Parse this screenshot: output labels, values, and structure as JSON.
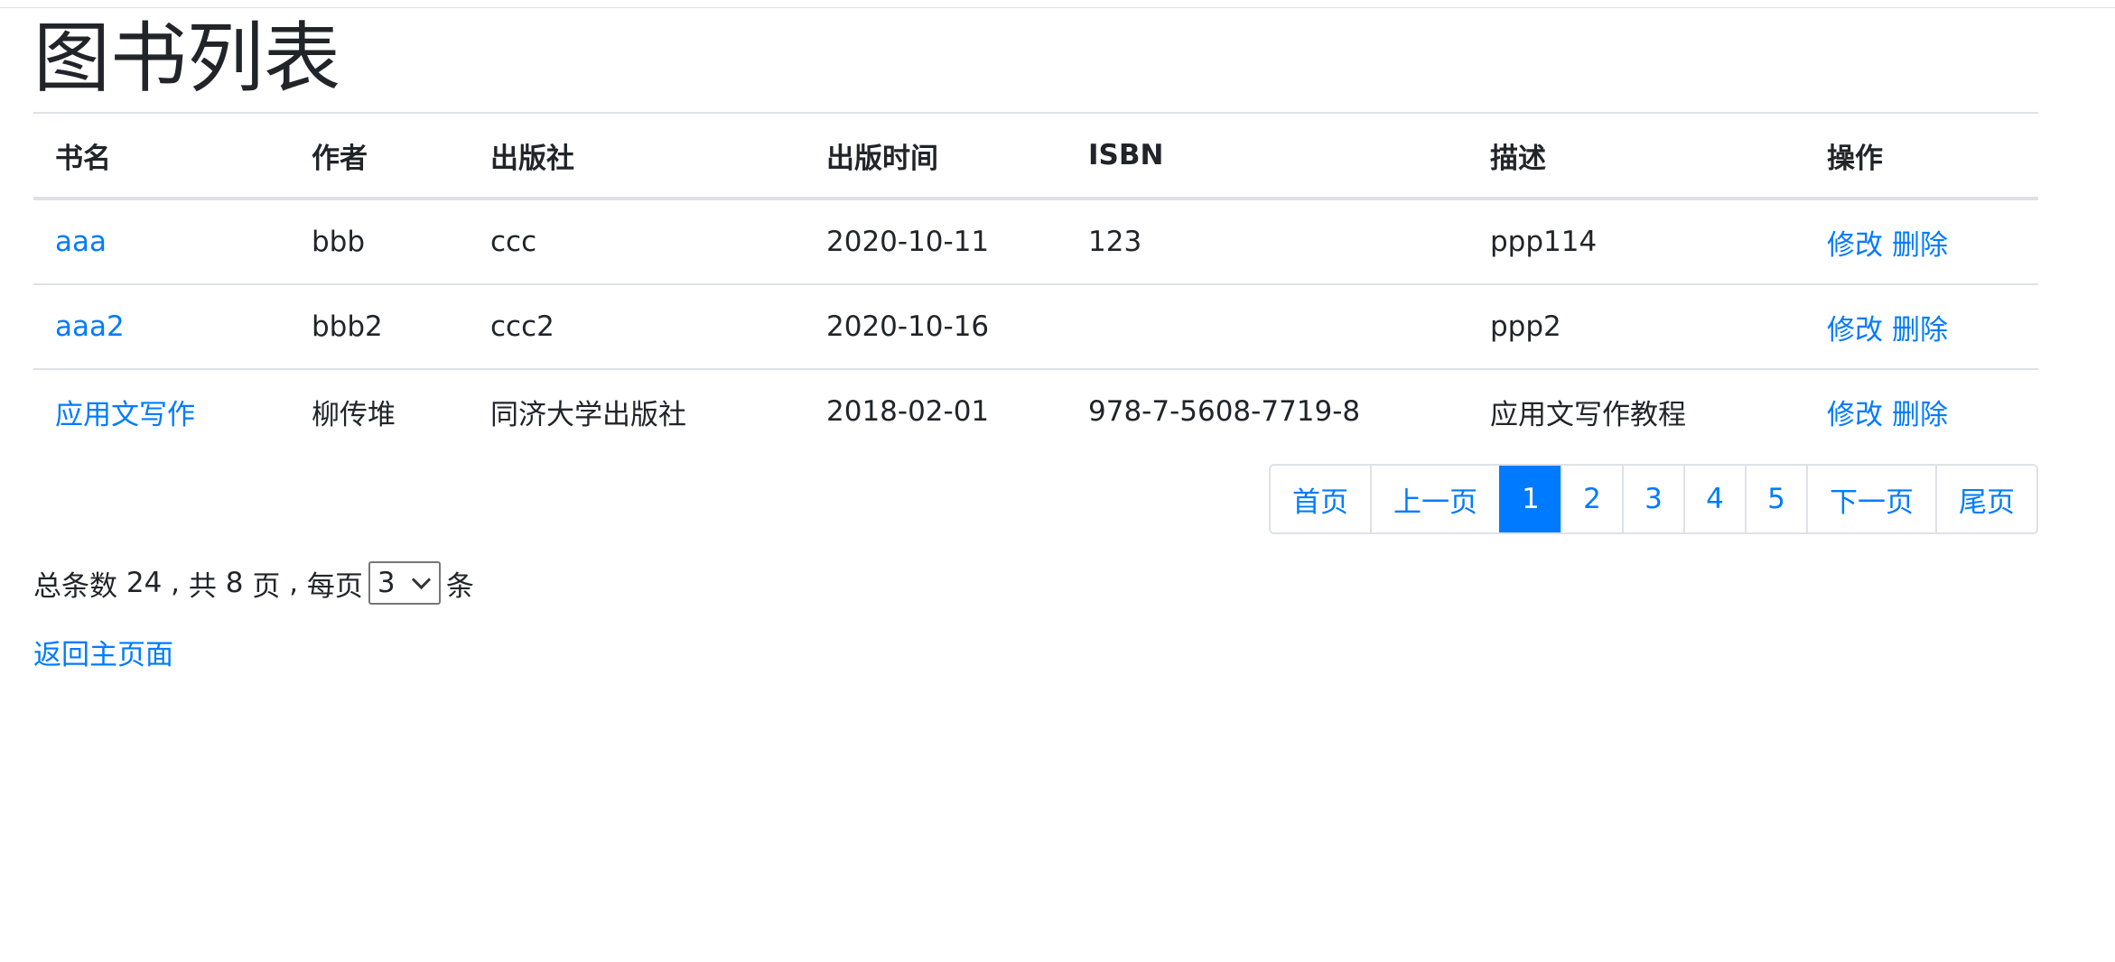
{
  "title": "图书列表",
  "table": {
    "headers": [
      "书名",
      "作者",
      "出版社",
      "出版时间",
      "ISBN",
      "描述",
      "操作"
    ],
    "rows": [
      {
        "name": "aaa",
        "author": "bbb",
        "publisher": "ccc",
        "date": "2020-10-11",
        "isbn": "123",
        "desc": "ppp114",
        "edit": "修改",
        "delete": "删除"
      },
      {
        "name": "aaa2",
        "author": "bbb2",
        "publisher": "ccc2",
        "date": "2020-10-16",
        "isbn": "",
        "desc": "ppp2",
        "edit": "修改",
        "delete": "删除"
      },
      {
        "name": "应用文写作",
        "author": "柳传堆",
        "publisher": "同济大学出版社",
        "date": "2018-02-01",
        "isbn": "978-7-5608-7719-8",
        "desc": "应用文写作教程",
        "edit": "修改",
        "delete": "删除"
      }
    ]
  },
  "pagination": {
    "first": "首页",
    "prev": "上一页",
    "pages": [
      "1",
      "2",
      "3",
      "4",
      "5"
    ],
    "active_page": "1",
    "next": "下一页",
    "last": "尾页"
  },
  "summary": {
    "total_prefix": "总条数",
    "total": "24",
    "sep1": ",",
    "pages_prefix": "共",
    "pages": "8",
    "pages_suffix": "页",
    "sep2": ",",
    "per_page_prefix": "每页",
    "per_page": "3",
    "per_page_suffix": "条"
  },
  "back_link": "返回主页面",
  "colors": {
    "link": "#007bff",
    "border": "#dee2e6",
    "text": "#212529"
  }
}
